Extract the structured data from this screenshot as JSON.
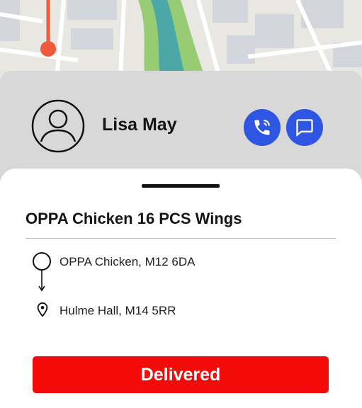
{
  "colors": {
    "accent_blue": "#2f56e3",
    "delivered_red": "#f50a0a",
    "map_background": "#e9e7e1",
    "route_orange": "#ef5a3c",
    "river_teal": "#4ba8a6",
    "park_green": "#97cc75"
  },
  "map": {
    "icons": [
      "location-pin-icon"
    ]
  },
  "driver": {
    "name": "Lisa May",
    "avatar_icon": "user-circle-icon",
    "call_icon": "phone-call-icon",
    "chat_icon": "chat-bubble-icon"
  },
  "order": {
    "title": "OPPA Chicken 16 PCS Wings",
    "pickup": "OPPA Chicken, M12 6DA",
    "dropoff": "Hulme Hall, M14 5RR",
    "pickup_icon": "route-start-icon",
    "dropoff_icon": "location-pin-icon"
  },
  "actions": {
    "delivered_label": "Delivered"
  }
}
